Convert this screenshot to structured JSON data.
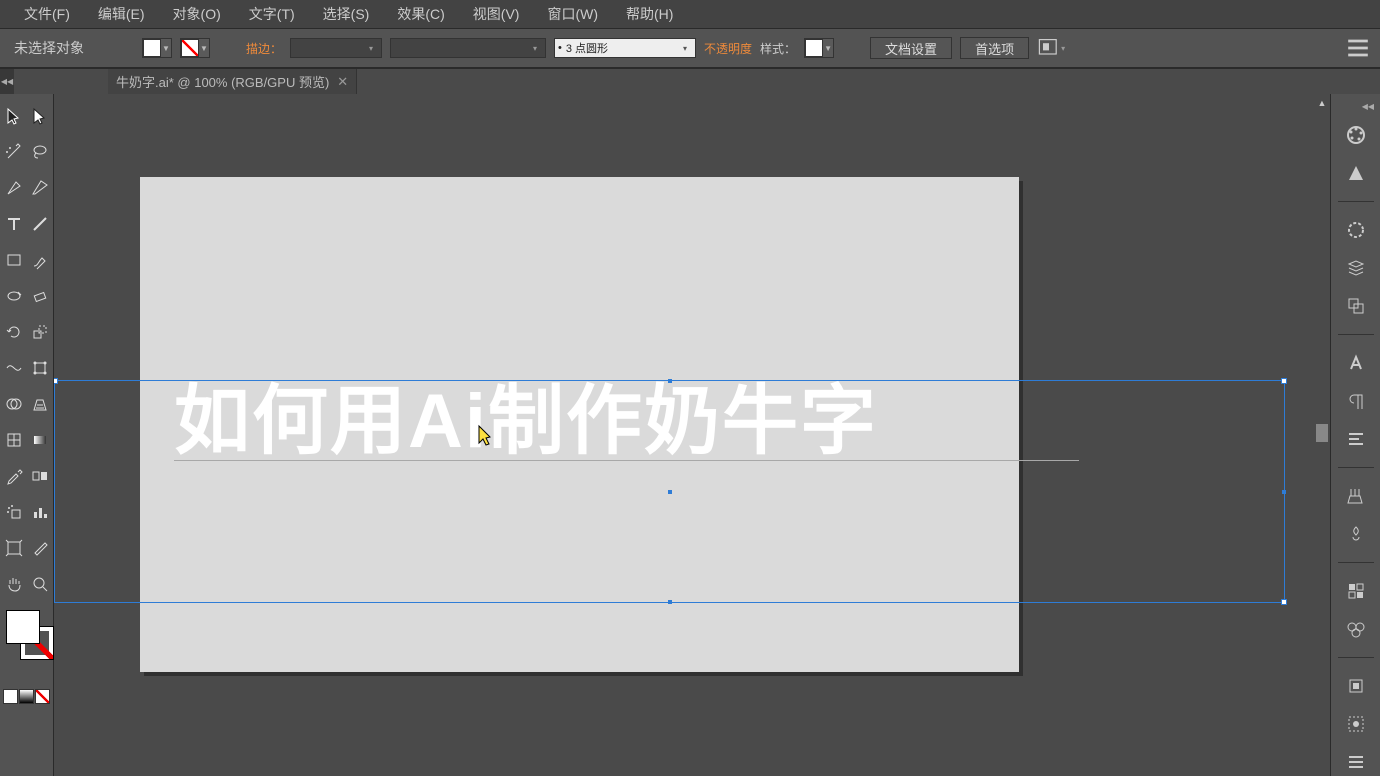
{
  "menu": [
    "文件(F)",
    "编辑(E)",
    "对象(O)",
    "文字(T)",
    "选择(S)",
    "效果(C)",
    "视图(V)",
    "窗口(W)",
    "帮助(H)"
  ],
  "ctrlbar": {
    "noselect": "未选择对象",
    "strokeLabel": "描边：",
    "strokeWidth": "",
    "brushLabel": "",
    "styleDashLabel": "3 点圆形",
    "opacityLabel": "不透明度",
    "styleLabel": "样式：",
    "docSetupBtn": "文档设置",
    "prefBtn": "首选项"
  },
  "tab": {
    "title": "牛奶字.ai* @ 100% (RGB/GPU 预览)",
    "close": "✕"
  },
  "canvas": {
    "text": "如何用Ai制作奶牛字"
  },
  "tools": {
    "primary": [
      [
        "selection",
        "direct-selection"
      ],
      [
        "magic-wand",
        "lasso"
      ],
      [
        "pen",
        "curvature"
      ],
      [
        "type",
        "line"
      ],
      [
        "rectangle",
        "paintbrush"
      ],
      [
        "shaper",
        "eraser"
      ],
      [
        "rotate",
        "scale"
      ],
      [
        "width",
        "free-transform"
      ],
      [
        "shape-builder",
        "perspective"
      ],
      [
        "mesh",
        "gradient"
      ],
      [
        "eyedropper",
        "blend"
      ],
      [
        "symbol-sprayer",
        "column-graph"
      ],
      [
        "artboard",
        "slice"
      ],
      [
        "hand",
        "zoom"
      ]
    ]
  },
  "rightPanels": [
    "color",
    "color-guide",
    "stroke",
    "opacity",
    "pathfinder",
    "character",
    "paragraph",
    "align",
    "brushes",
    "symbols",
    "swatches",
    "color-themes",
    "transform",
    "appearance",
    "layers"
  ]
}
